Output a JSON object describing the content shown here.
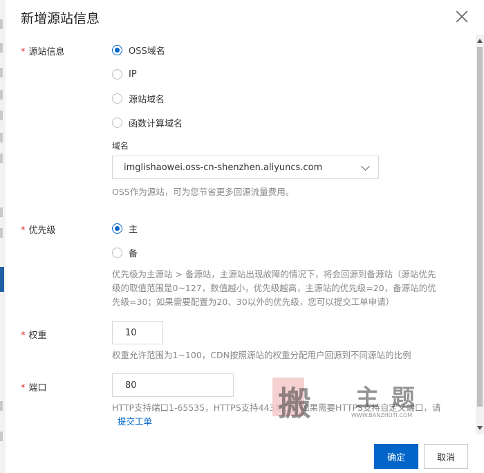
{
  "dialog": {
    "title": "新增源站信息",
    "required_mark": "*"
  },
  "origin": {
    "label": "源站信息",
    "options": [
      "OSS域名",
      "IP",
      "源站域名",
      "函数计算域名"
    ],
    "selected": "OSS域名",
    "domain_caption": "域名",
    "domain_value": "imglishaowei.oss-cn-shenzhen.aliyuncs.com",
    "help": "OSS作为源站，可为您节省更多回源流量费用。"
  },
  "priority": {
    "label": "优先级",
    "options": [
      "主",
      "备"
    ],
    "selected": "主",
    "help": "优先级为主源站 > 备源站，主源站出现故障的情况下，将会回源到备源站（源站优先级的取值范围是0~127，数值越小，优先级越高，主源站的优先级=20，备源站的优先级=30；如果需要配置为20、30以外的优先级，您可以提交工单申请）"
  },
  "weight": {
    "label": "权重",
    "value": "10",
    "help": "权重允许范围为1~100，CDN按照源站的权重分配用户回源到不同源站的比例"
  },
  "port": {
    "label": "端口",
    "value": "80",
    "help": "HTTP支持端口1-65535，HTTPS支持443端口，如果需要HTTPS支持自定义端口，请",
    "link": "提交工单"
  },
  "watermark": {
    "chars": [
      "搬",
      "主",
      "题"
    ],
    "url": "WWW.BANZHUTI.COM"
  },
  "footer": {
    "confirm": "确定",
    "cancel": "取消"
  },
  "colors": {
    "primary": "#0064c8",
    "required": "#d93026",
    "help_text": "#888888"
  }
}
